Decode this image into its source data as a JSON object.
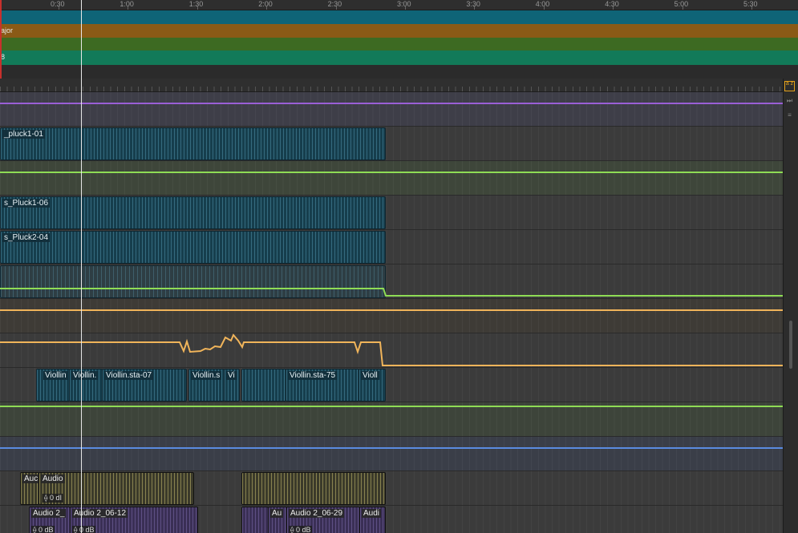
{
  "ruler": {
    "time_labels": [
      "0:30",
      "1:00",
      "1:30",
      "2:00",
      "2:30",
      "3:00",
      "3:30",
      "4:00",
      "4:30",
      "5:00",
      "5:30"
    ]
  },
  "global_tracks": [
    {
      "label": "",
      "color": "#0f6477"
    },
    {
      "label": "ajor",
      "color": "#8a5a16"
    },
    {
      "label": "",
      "color": "#3d6a22"
    },
    {
      "label": "8",
      "color": "#127a59"
    }
  ],
  "regions": {
    "pluck1_01": "_pluck1-01",
    "pluck1_06": "s_Pluck1-06",
    "pluck2_04": "s_Pluck2-04",
    "violin_a": "Viollin",
    "violin_b": "Viollin.",
    "violin_sta07": "Viollin.sta-07",
    "violin_s": "Viollin.s",
    "violin_vi": "Vi",
    "violin_sta75": "Viollin.sta-75",
    "violin_end": "Violl",
    "audio_a": "Auc",
    "audio_b": "Audio",
    "audio_b_gain": "0 dI",
    "audio2_a": "Audio 2_",
    "audio2_a_gain": "0 dB",
    "audio2_0612": "Audio 2_06-12",
    "audio2_0612_gain": "0 dB",
    "audio2_au": "Au",
    "audio2_0629": "Audio 2_06-29",
    "audio2_0629_gain": "0 dB",
    "audio2_end": "Audi"
  },
  "sidebar": {
    "sort_icon": "az-sort-icon",
    "sort_glyph": "a z"
  },
  "colors": {
    "purple_line": "#9a5fd6",
    "green_line": "#8fdc55",
    "orange_line": "#f0b45a",
    "blue_line": "#5a8be0",
    "accent": "#e6a21a"
  }
}
